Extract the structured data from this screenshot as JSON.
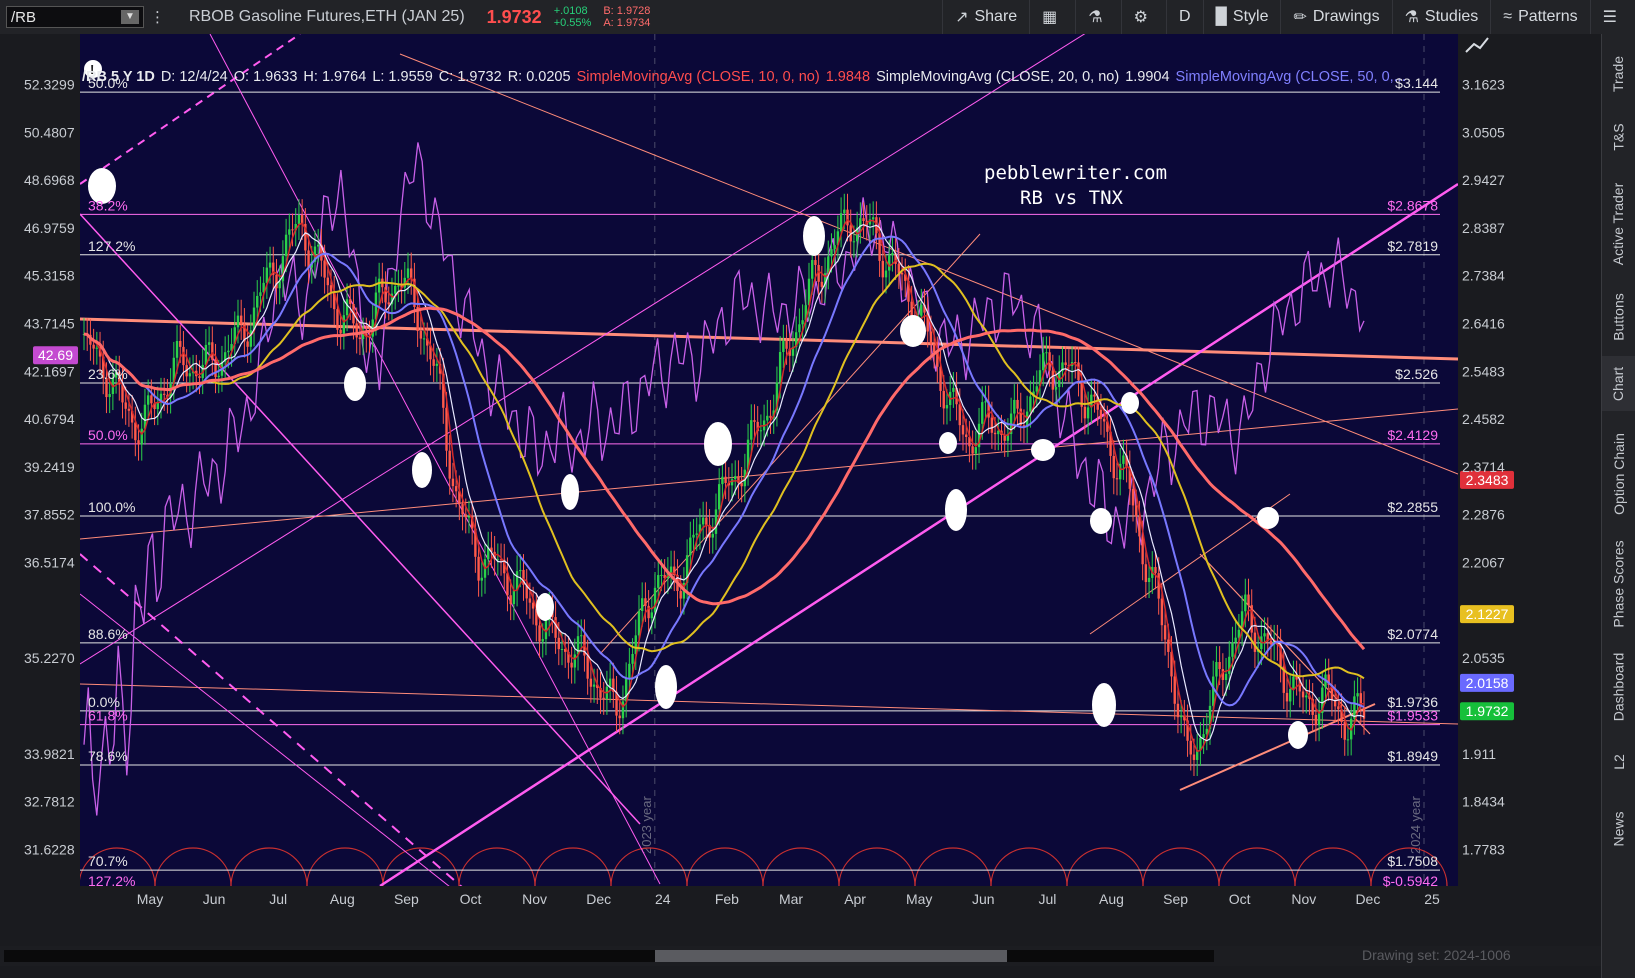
{
  "toolbar": {
    "symbol": "/RB",
    "description": "RBOB Gasoline Futures,ETH (JAN 25)",
    "last_price": "1.9732",
    "change": "+.0108",
    "change_pct": "+0.55%",
    "bid": "B: 1.9728",
    "ask": "A: 1.9734",
    "share_label": "Share",
    "aggregation_label": "D",
    "style_label": "Style",
    "drawings_label": "Drawings",
    "studies_label": "Studies",
    "patterns_label": "Patterns"
  },
  "header": {
    "symbol_period": "/RB 5 Y 1D",
    "date": "D: 12/4/24",
    "open": "O: 1.9633",
    "high": "H: 1.9764",
    "low": "L: 1.9559",
    "close": "C: 1.9732",
    "range": "R: 0.0205",
    "sma10_label": "SimpleMovingAvg (CLOSE, 10, 0, no)",
    "sma10_value": "1.9848",
    "sma20_label": "SimpleMovingAvg (CLOSE, 20, 0, no)",
    "sma20_value": "1.9904",
    "sma50_label": "SimpleMovingAvg (CLOSE, 50, 0,..."
  },
  "watermark": {
    "line1": "pebblewriter.com",
    "line2": "RB vs TNX"
  },
  "colors": {
    "background": "#0b0838",
    "price_up": "#2bd14a",
    "price_down": "#ff5a4a",
    "sma10": "#d42a2a",
    "sma20": "#e8e8ff",
    "sma50": "#7878ff",
    "sma100": "#e0c020",
    "sma200": "#ff6a6a",
    "tnx": "#c860e8",
    "fib_white": "#e6e6e6",
    "fib_magenta": "#ff6cf0",
    "trend_magenta": "#ff5cf0",
    "trend_salmon": "#ff8c7a",
    "cycle_arcs": "#c83030"
  },
  "side_tabs": [
    "Trade",
    "T&S",
    "Active Trader",
    "Buttons",
    "Chart",
    "Option Chain",
    "Phase Scores",
    "Dashboard",
    "L2",
    "News"
  ],
  "drawing_set_label": "Drawing set: 2024-1006",
  "chart_data": {
    "type": "line",
    "title": "RB vs TNX",
    "xlabel": "",
    "ylabel": "",
    "grid": true,
    "x_ticks": [
      "May",
      "Jun",
      "Jul",
      "Aug",
      "Sep",
      "Oct",
      "Nov",
      "Dec",
      "24",
      "Feb",
      "Mar",
      "Apr",
      "May",
      "Jun",
      "Jul",
      "Aug",
      "Sep",
      "Oct",
      "Nov",
      "Dec",
      "25"
    ],
    "year_markers": [
      "2023 year",
      "2024 year"
    ],
    "y_right_ticks": [
      3.1623,
      3.0505,
      2.9427,
      2.8387,
      2.7384,
      2.6416,
      2.5483,
      2.4582,
      2.3714,
      2.2876,
      2.2067,
      2.0535,
      1.911,
      1.8434,
      1.7783
    ],
    "y_left_ticks": [
      52.3299,
      50.4807,
      48.6968,
      46.9759,
      45.3158,
      43.7145,
      42.1697,
      40.6794,
      39.2419,
      37.8552,
      36.5174,
      35.227,
      33.9821,
      32.7812,
      31.6228
    ],
    "y_right_range": [
      1.73,
      3.26
    ],
    "badges": [
      {
        "label": "42.69",
        "color": "#c44ad0",
        "axis": "left",
        "value": 42.69
      },
      {
        "label": "2.3483",
        "color": "#e0303a",
        "axis": "right",
        "value": 2.3483
      },
      {
        "label": "2.1227",
        "color": "#e8c020",
        "axis": "right",
        "value": 2.1227
      },
      {
        "label": "2.0158",
        "color": "#6a6aff",
        "axis": "right",
        "value": 2.0158
      },
      {
        "label": "1.9732",
        "color": "#16c03a",
        "axis": "right",
        "value": 1.9732
      }
    ],
    "fib_levels": [
      {
        "pct": "50.0%",
        "price": "$3.144",
        "value": 3.144,
        "color": "white"
      },
      {
        "pct": "38.2%",
        "price": "$2.8678",
        "value": 2.8678,
        "color": "magenta"
      },
      {
        "pct": "127.2%",
        "price": "$2.7819",
        "value": 2.7819,
        "color": "white"
      },
      {
        "pct": "23.6%",
        "price": "$2.526",
        "value": 2.526,
        "color": "white"
      },
      {
        "pct": "50.0%",
        "price": "$2.4129",
        "value": 2.4129,
        "color": "magenta"
      },
      {
        "pct": "100.0%",
        "price": "$2.2855",
        "value": 2.2855,
        "color": "white"
      },
      {
        "pct": "88.6%",
        "price": "$2.0774",
        "value": 2.0774,
        "color": "white"
      },
      {
        "pct": "0.0%",
        "price": "$1.9736",
        "value": 1.9736,
        "color": "white"
      },
      {
        "pct": "61.8%",
        "price": "$1.9533",
        "value": 1.9533,
        "color": "magenta"
      },
      {
        "pct": "78.6%",
        "price": "$1.8949",
        "value": 1.8949,
        "color": "white"
      },
      {
        "pct": "70.7%",
        "price": "$1.7508",
        "value": 1.7508,
        "color": "white"
      },
      {
        "pct": "127.2%",
        "price": "$-0.5942",
        "value": 1.725,
        "color": "magenta"
      }
    ],
    "series": [
      {
        "name": "RB close (approx.)",
        "values": [
          2.6,
          2.56,
          2.48,
          2.44,
          2.52,
          2.57,
          2.55,
          2.58,
          2.62,
          2.7,
          2.78,
          2.85,
          2.75,
          2.66,
          2.62,
          2.68,
          2.74,
          2.66,
          2.52,
          2.3,
          2.22,
          2.2,
          2.17,
          2.12,
          2.08,
          2.06,
          2.02,
          1.97,
          2.08,
          2.18,
          2.17,
          2.24,
          2.3,
          2.35,
          2.42,
          2.5,
          2.62,
          2.72,
          2.8,
          2.86,
          2.83,
          2.76,
          2.69,
          2.6,
          2.48,
          2.42,
          2.46,
          2.43,
          2.5,
          2.56,
          2.55,
          2.5,
          2.42,
          2.34,
          2.2,
          2.08,
          1.9,
          1.96,
          2.06,
          2.12,
          2.08,
          2.03,
          1.98,
          2.0,
          1.96,
          1.97
        ]
      },
      {
        "name": "TNX (approx.)",
        "values": [
          33.6,
          33.8,
          34.5,
          36.0,
          37.4,
          38.0,
          38.6,
          39.4,
          40.5,
          42.3,
          45.8,
          44.0,
          46.5,
          48.8,
          44.0,
          42.0,
          47.6,
          49.4,
          46.8,
          44.7,
          43.0,
          41.5,
          40.6,
          39.6,
          40.3,
          40.0,
          40.6,
          40.5,
          41.3,
          42.1,
          42.6,
          42.5,
          43.2,
          44.5,
          44.5,
          44.0,
          44.3,
          44.6,
          45.4,
          46.1,
          47.2,
          46.2,
          45.0,
          43.6,
          42.9,
          43.4,
          44.1,
          44.6,
          43.8,
          42.4,
          40.3,
          39.0,
          37.8,
          37.6,
          38.4,
          39.8,
          40.6,
          41.0,
          40.4,
          40.4,
          42.8,
          44.0,
          45.0,
          45.4,
          45.2,
          44.1
        ]
      }
    ]
  }
}
